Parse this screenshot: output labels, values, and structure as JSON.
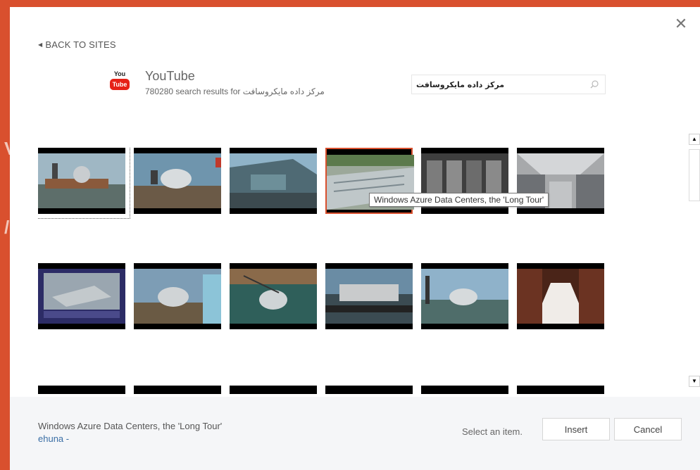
{
  "dialog": {
    "back_label": "BACK TO SITES",
    "close_glyph": "✕"
  },
  "site": {
    "logo_top": "You",
    "logo_bottom": "Tube",
    "name": "YouTube",
    "result_count_text": "780280 search results for",
    "query": "مرکز داده مایکروسافت"
  },
  "search": {
    "value": "مرکز داده مایکروسافت",
    "icon": "search-icon"
  },
  "tooltip": {
    "text": "Windows Azure Data Centers, the 'Long Tour'"
  },
  "scrollbar": {
    "up_glyph": "▲",
    "down_glyph": "▼"
  },
  "footer": {
    "selected_title": "Windows Azure Data Centers, the 'Long Tour'",
    "selected_author": "ehuna -",
    "status": "Select an item.",
    "insert_label": "Insert",
    "cancel_label": "Cancel"
  },
  "colors": {
    "accent": "#d9502e",
    "youtube_red": "#e62117",
    "link": "#3a6ea5"
  }
}
